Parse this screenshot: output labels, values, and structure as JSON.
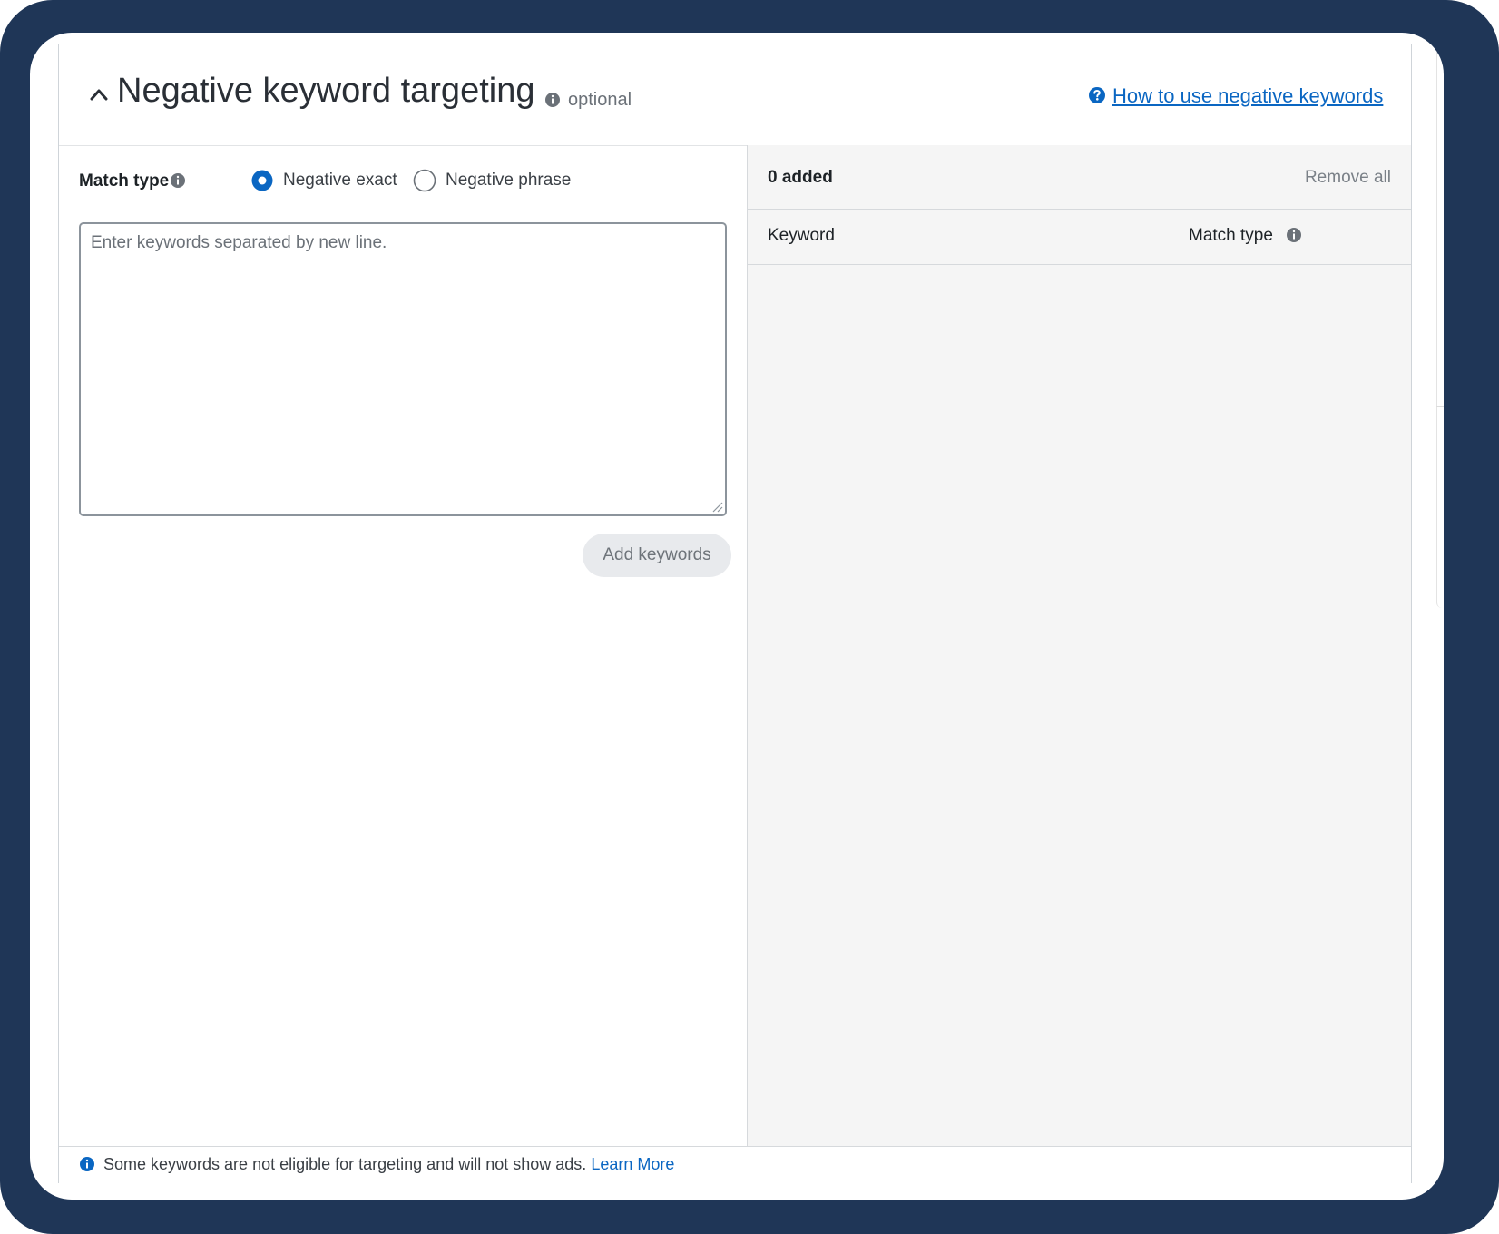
{
  "section": {
    "title": "Negative keyword targeting",
    "optional_label": "optional",
    "help_link": "How to use negative keywords"
  },
  "entry": {
    "match_type_label": "Match type",
    "options": [
      {
        "label": "Negative exact",
        "selected": true
      },
      {
        "label": "Negative phrase",
        "selected": false
      }
    ],
    "textarea_placeholder": "Enter keywords separated by new line.",
    "add_button": "Add keywords"
  },
  "added_list": {
    "count_label": "0 added",
    "remove_all": "Remove all",
    "columns": [
      "Keyword",
      "Match type"
    ]
  },
  "footer": {
    "message": "Some keywords are not eligible for targeting and will not show ads.",
    "link": "Learn More"
  },
  "colors": {
    "frame": "#1f3657",
    "accent": "#0a66c2",
    "panel_bg": "#f5f5f5"
  },
  "icons": [
    "chevron-up-icon",
    "info-icon",
    "help-icon",
    "resize-grip-icon"
  ]
}
